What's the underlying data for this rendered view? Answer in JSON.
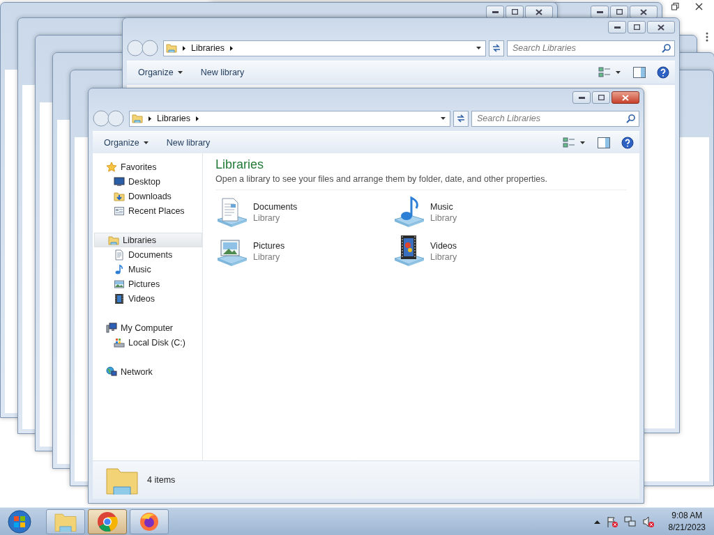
{
  "background_windows": [
    {
      "kind": "browser"
    },
    {
      "kind": "blank"
    },
    {
      "kind": "blank"
    },
    {
      "kind": "blank"
    },
    {
      "kind": "blank"
    },
    {
      "kind": "blank"
    },
    {
      "kind": "blank"
    },
    {
      "kind": "explorer",
      "address": "Libraries",
      "search": {
        "placeholder": "Search Libraries"
      },
      "toolbar": [
        {
          "label": "Organize",
          "kind": "menu"
        },
        {
          "label": "New library",
          "kind": "button"
        }
      ]
    }
  ],
  "window": {
    "address": "Libraries",
    "search": {
      "placeholder": "Search Libraries"
    },
    "toolbar": [
      {
        "label": "Organize",
        "kind": "menu"
      },
      {
        "label": "New library",
        "kind": "button"
      }
    ],
    "nav": [
      {
        "label": "Favorites",
        "kind": "star",
        "selected": false,
        "children": [
          {
            "label": "Desktop",
            "kind": "desktop",
            "selected": false
          },
          {
            "label": "Downloads",
            "kind": "downloads",
            "selected": false
          },
          {
            "label": "Recent Places",
            "kind": "recent",
            "selected": false
          }
        ]
      },
      {
        "label": "Libraries",
        "kind": "library",
        "selected": true,
        "children": [
          {
            "label": "Documents",
            "kind": "documents",
            "selected": false
          },
          {
            "label": "Music",
            "kind": "music",
            "selected": false
          },
          {
            "label": "Pictures",
            "kind": "pictures",
            "selected": false
          },
          {
            "label": "Videos",
            "kind": "videos",
            "selected": false
          }
        ]
      },
      {
        "label": "My Computer",
        "kind": "computer",
        "selected": false,
        "children": [
          {
            "label": "Local Disk (C:)",
            "kind": "disk",
            "selected": false
          }
        ]
      },
      {
        "label": "Network",
        "kind": "network",
        "selected": false
      }
    ],
    "heading": "Libraries",
    "description": "Open a library to see your files and arrange them by folder, date, and other properties.",
    "libraries": [
      {
        "name": "Documents",
        "type": "Library",
        "kind": "documents"
      },
      {
        "name": "Music",
        "type": "Library",
        "kind": "music"
      },
      {
        "name": "Pictures",
        "type": "Library",
        "kind": "pictures"
      },
      {
        "name": "Videos",
        "type": "Library",
        "kind": "videos"
      }
    ],
    "status": "4 items"
  },
  "taskbar": {
    "apps": [
      {
        "kind": "explorer",
        "selected": false
      },
      {
        "kind": "chrome",
        "selected": true
      },
      {
        "kind": "firefox",
        "selected": false
      }
    ],
    "clock": {
      "time": "9:08 AM",
      "date": "8/21/2023"
    }
  }
}
